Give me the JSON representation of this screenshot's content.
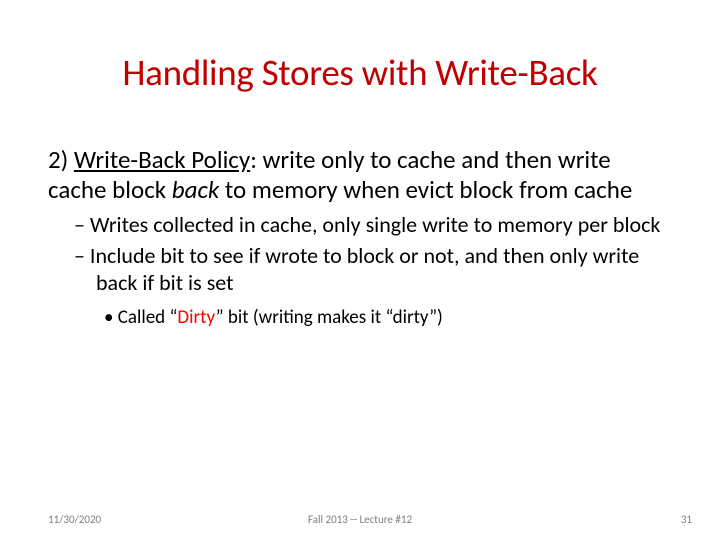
{
  "title": "Handling Stores with Write-Back",
  "body": {
    "lead_number": "2) ",
    "policy_label": "Write-Back Policy",
    "policy_after": ": write only to cache and then write cache block ",
    "back_word": "back",
    "policy_tail": " to memory when evict block from cache",
    "sub1": [
      "– Writes collected in cache, only single write to memory per block",
      "– Include bit to see if wrote to block or not, and then only write back if bit is set"
    ],
    "sub2_prefix": "• Called “",
    "sub2_red": "Dirty",
    "sub2_suffix": "” bit (writing makes it “dirty”)"
  },
  "footer": {
    "date": "11/30/2020",
    "center": "Fall 2013 -- Lecture #12",
    "page": "31"
  }
}
